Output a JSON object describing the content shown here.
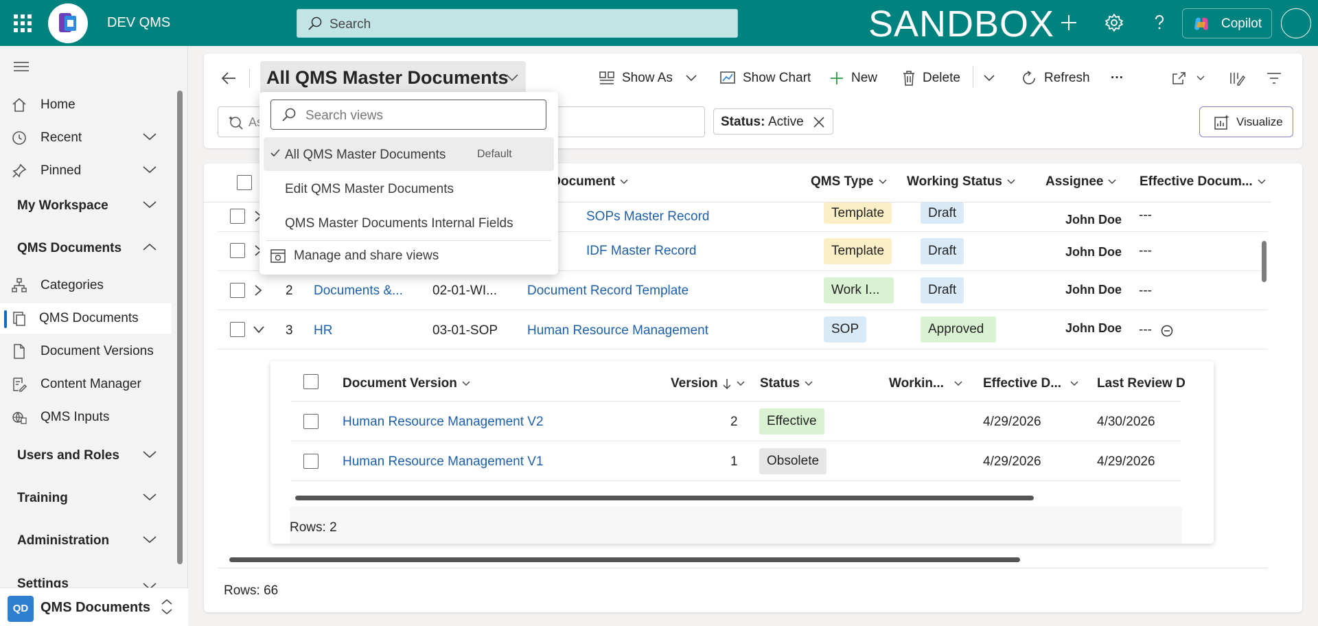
{
  "topbar": {
    "app_name": "DEV QMS",
    "search_placeholder": "Search",
    "environment": "SANDBOX",
    "copilot_label": "Copilot"
  },
  "sidebar": {
    "items": [
      {
        "label": "Home"
      },
      {
        "label": "Recent"
      },
      {
        "label": "Pinned"
      }
    ],
    "my_workspace": "My Workspace",
    "qms_documents_group": "QMS Documents",
    "qms_items": [
      {
        "label": "Categories"
      },
      {
        "label": "QMS Documents"
      },
      {
        "label": "Document Versions"
      },
      {
        "label": "Content Manager"
      },
      {
        "label": "QMS Inputs"
      }
    ],
    "groups": [
      "Users and Roles",
      "Training",
      "Administration",
      "Settings"
    ],
    "footer": {
      "badge": "QD",
      "label": "QMS Documents"
    }
  },
  "commandbar": {
    "view_title": "All QMS Master Documents",
    "show_as": "Show As",
    "show_chart": "Show Chart",
    "new": "New",
    "delete": "Delete",
    "refresh": "Refresh",
    "more": "···",
    "keyword_placeholder": "As",
    "filter_key": "Status:",
    "filter_value": "Active",
    "visualize": "Visualize"
  },
  "grid": {
    "headers": {
      "master_document": "er Document",
      "qms_type": "QMS Type",
      "working_status": "Working Status",
      "assignee": "Assignee",
      "effective": "Effective Docum..."
    },
    "rows": [
      {
        "num": "",
        "category": "",
        "code": "",
        "doc": "SOPs Master Record",
        "type": "Template",
        "status": "Draft",
        "assignee": "John Doe",
        "effective": "---"
      },
      {
        "num": "",
        "category": "",
        "code": "",
        "doc": "IDF Master Record",
        "type": "Template",
        "status": "Draft",
        "assignee": "John Doe",
        "effective": "---"
      },
      {
        "num": "2",
        "category": "Documents &...",
        "code": "02-01-WI...",
        "doc": "Document Record Template",
        "type": "Work I...",
        "status": "Draft",
        "assignee": "John Doe",
        "effective": "---"
      },
      {
        "num": "3",
        "category": "HR",
        "code": "03-01-SOP",
        "doc": "Human Resource Management",
        "type": "SOP",
        "status": "Approved",
        "assignee": "John Doe",
        "effective": "---"
      }
    ],
    "footer": "Rows: 66"
  },
  "subgrid": {
    "headers": {
      "version_name": "Document Version",
      "version": "Version",
      "status": "Status",
      "working": "Workin...",
      "effective": "Effective D...",
      "last_review": "Last Review D"
    },
    "rows": [
      {
        "name": "Human Resource Management V2",
        "version": "2",
        "status": "Effective",
        "effective": "4/29/2026",
        "last_review": "4/30/2026"
      },
      {
        "name": "Human Resource Management V1",
        "version": "1",
        "status": "Obsolete",
        "effective": "4/29/2026",
        "last_review": "4/29/2026"
      }
    ],
    "footer": "Rows: 2"
  },
  "viewmenu": {
    "search_placeholder": "Search views",
    "items": [
      {
        "label": "All QMS Master Documents",
        "tag": "Default"
      },
      {
        "label": "Edit QMS Master Documents"
      },
      {
        "label": "QMS Master Documents Internal Fields"
      }
    ],
    "manage": "Manage and share views"
  },
  "colors": {
    "topbar": "#00827f",
    "link": "#1d5fa9",
    "accent": "#0f6cbd"
  }
}
